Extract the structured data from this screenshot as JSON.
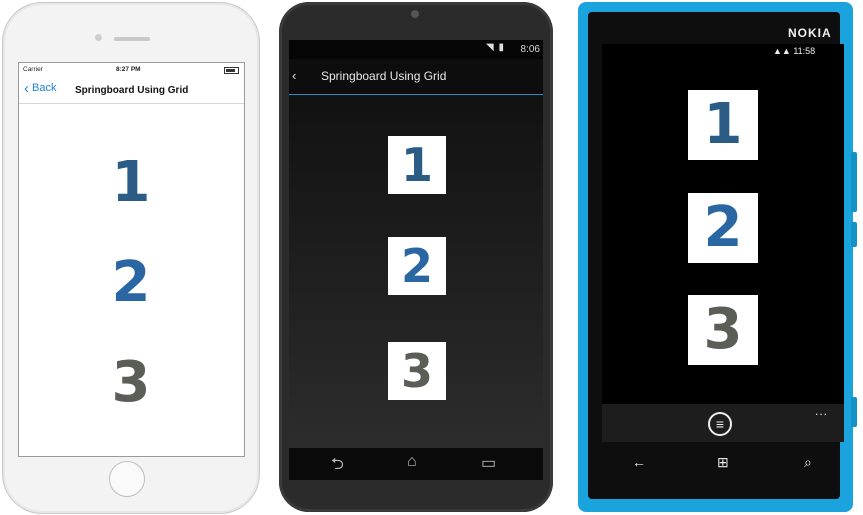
{
  "iphone": {
    "carrier": "Carrier",
    "time": "8:27 PM",
    "back_label": "Back",
    "title": "Springboard Using Grid",
    "tiles": [
      "1",
      "2",
      "3"
    ]
  },
  "android": {
    "time": "8:06",
    "back_glyph": "‹",
    "title": "Springboard Using Grid",
    "tiles": [
      "1",
      "2",
      "3"
    ],
    "nav_icons": [
      "back-icon",
      "home-icon",
      "recents-icon"
    ]
  },
  "lumia": {
    "brand": "NOKIA",
    "time": "11:58",
    "tiles": [
      "1",
      "2",
      "3"
    ],
    "appbar_more": "...",
    "hw_icons": [
      "back-icon",
      "windows-icon",
      "search-icon"
    ]
  },
  "colors": {
    "tile1": "#2b5c86",
    "tile2": "#2a66a2",
    "tile3": "#5b5d57",
    "ios_blue": "#1e7fd6",
    "android_accent": "#2d8bc6",
    "lumia_cyan": "#1aa3dc"
  }
}
